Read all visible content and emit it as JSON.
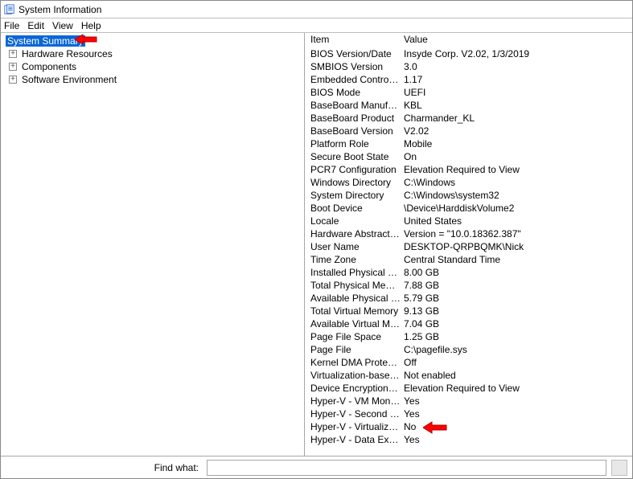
{
  "window": {
    "title": "System Information"
  },
  "menu": {
    "file": "File",
    "edit": "Edit",
    "view": "View",
    "help": "Help"
  },
  "tree": {
    "root": "System Summary",
    "children": [
      "Hardware Resources",
      "Components",
      "Software Environment"
    ]
  },
  "list": {
    "header_item": "Item",
    "header_value": "Value",
    "rows": [
      {
        "item": "BIOS Version/Date",
        "value": "Insyde Corp. V2.02, 1/3/2019"
      },
      {
        "item": "SMBIOS Version",
        "value": "3.0"
      },
      {
        "item": "Embedded Controller V...",
        "value": "1.17"
      },
      {
        "item": "BIOS Mode",
        "value": "UEFI"
      },
      {
        "item": "BaseBoard Manufacturer",
        "value": "KBL"
      },
      {
        "item": "BaseBoard Product",
        "value": "Charmander_KL"
      },
      {
        "item": "BaseBoard Version",
        "value": "V2.02"
      },
      {
        "item": "Platform Role",
        "value": "Mobile"
      },
      {
        "item": "Secure Boot State",
        "value": "On"
      },
      {
        "item": "PCR7 Configuration",
        "value": "Elevation Required to View"
      },
      {
        "item": "Windows Directory",
        "value": "C:\\Windows"
      },
      {
        "item": "System Directory",
        "value": "C:\\Windows\\system32"
      },
      {
        "item": "Boot Device",
        "value": "\\Device\\HarddiskVolume2"
      },
      {
        "item": "Locale",
        "value": "United States"
      },
      {
        "item": "Hardware Abstraction L...",
        "value": "Version = \"10.0.18362.387\""
      },
      {
        "item": "User Name",
        "value": "DESKTOP-QRPBQMK\\Nick"
      },
      {
        "item": "Time Zone",
        "value": "Central Standard Time"
      },
      {
        "item": "Installed Physical Mem...",
        "value": "8.00 GB"
      },
      {
        "item": "Total Physical Memory",
        "value": "7.88 GB"
      },
      {
        "item": "Available Physical Mem...",
        "value": "5.79 GB"
      },
      {
        "item": "Total Virtual Memory",
        "value": "9.13 GB"
      },
      {
        "item": "Available Virtual Memory",
        "value": "7.04 GB"
      },
      {
        "item": "Page File Space",
        "value": "1.25 GB"
      },
      {
        "item": "Page File",
        "value": "C:\\pagefile.sys"
      },
      {
        "item": "Kernel DMA Protection",
        "value": "Off"
      },
      {
        "item": "Virtualization-based se...",
        "value": "Not enabled"
      },
      {
        "item": "Device Encryption Supp...",
        "value": "Elevation Required to View"
      },
      {
        "item": "Hyper-V - VM Monitor ...",
        "value": "Yes"
      },
      {
        "item": "Hyper-V - Second Level...",
        "value": "Yes"
      },
      {
        "item": "Hyper-V - Virtualizatio...",
        "value": "No"
      },
      {
        "item": "Hyper-V - Data Executi...",
        "value": "Yes"
      }
    ]
  },
  "findbar": {
    "label": "Find what:",
    "value": ""
  }
}
